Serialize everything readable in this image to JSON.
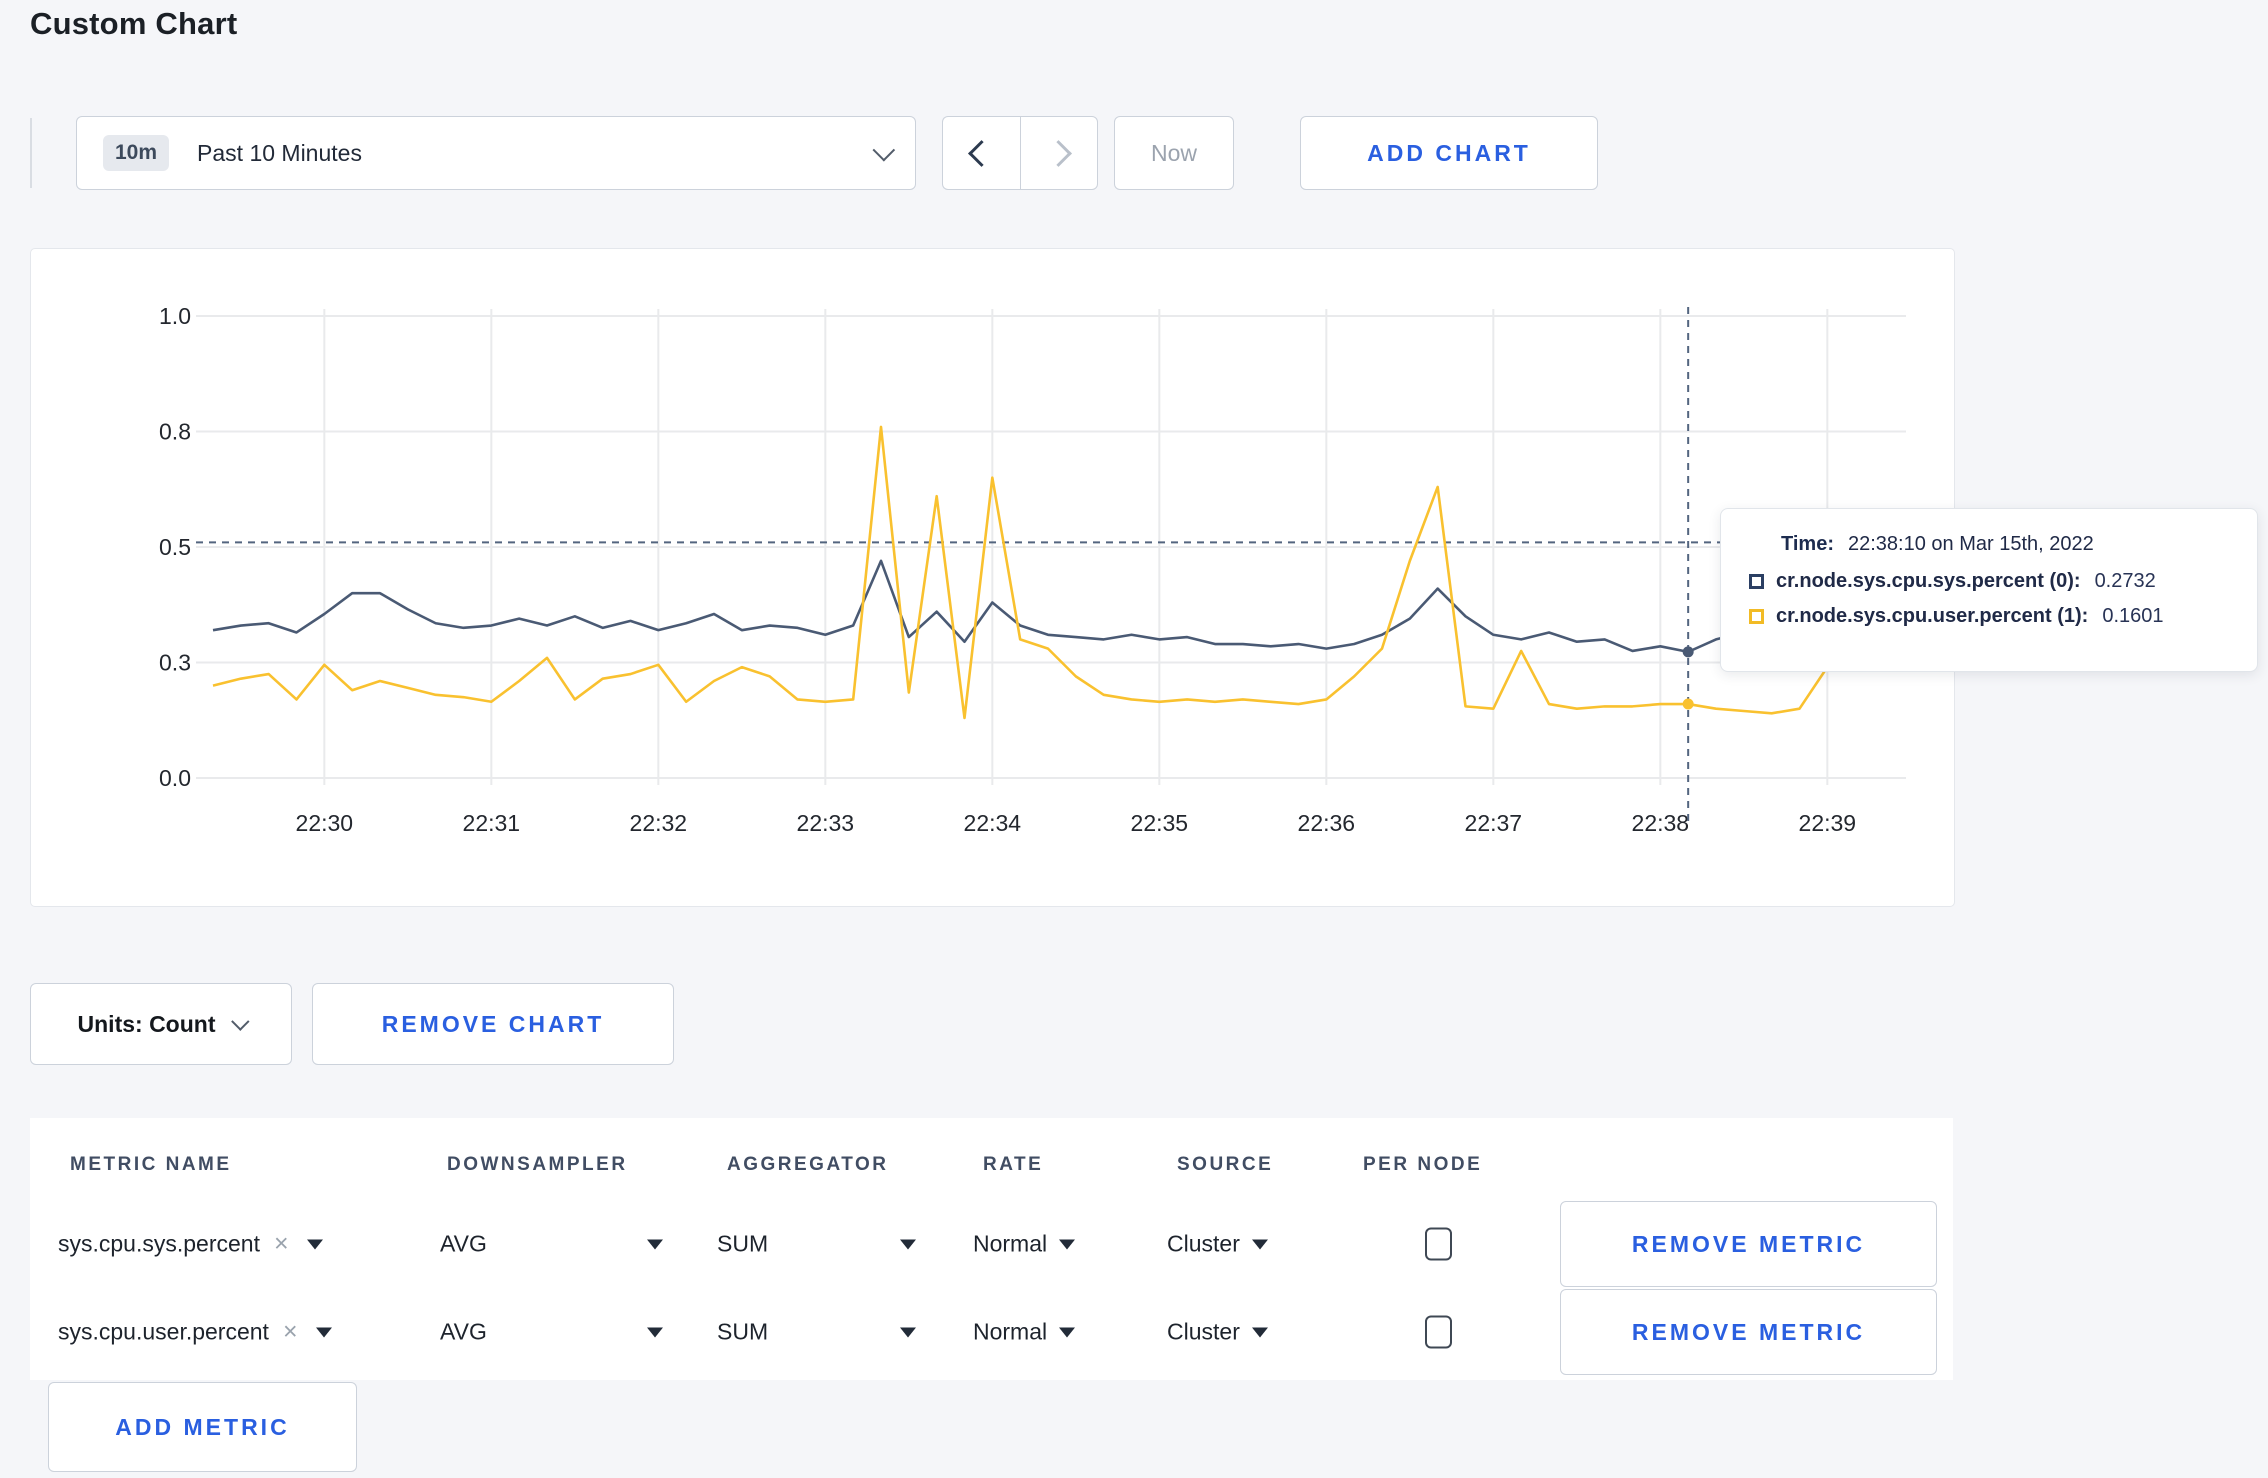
{
  "page": {
    "title": "Custom Chart"
  },
  "toolbar": {
    "time_window_badge": "10m",
    "time_window_label": "Past 10 Minutes",
    "dropdown_caret_icon": "chevron-down",
    "prev_icon": "chevron-left",
    "next_icon": "chevron-right",
    "now_label": "Now",
    "add_chart_label": "ADD CHART"
  },
  "colors": {
    "accent_blue": "#2a5fe0",
    "series_sys": "#4a5a74",
    "series_user": "#f9c12f",
    "grid": "#e9eaec",
    "crosshair": "#53657f",
    "axis_text": "#23272e"
  },
  "chart_data": {
    "type": "line",
    "title": "",
    "x_axis_ticks": [
      "22:30",
      "22:31",
      "22:32",
      "22:33",
      "22:34",
      "22:35",
      "22:36",
      "22:37",
      "22:38",
      "22:39"
    ],
    "y_axis_ticks": [
      {
        "label": "1.0",
        "value": 1.0
      },
      {
        "label": "0.8",
        "value": 0.75
      },
      {
        "label": "0.5",
        "value": 0.5
      },
      {
        "label": "0.3",
        "value": 0.25
      },
      {
        "label": "0.0",
        "value": 0.0
      }
    ],
    "ylim": [
      0,
      1
    ],
    "grid": true,
    "x_start_time": "22:29:20",
    "x_interval_seconds": 10,
    "series": [
      {
        "name": "cr.node.sys.cpu.sys.percent (0)",
        "color": "#4a5a74",
        "values": [
          0.32,
          0.33,
          0.335,
          0.315,
          0.355,
          0.4,
          0.4,
          0.365,
          0.335,
          0.325,
          0.33,
          0.345,
          0.33,
          0.35,
          0.325,
          0.34,
          0.32,
          0.335,
          0.355,
          0.32,
          0.33,
          0.325,
          0.31,
          0.33,
          0.47,
          0.305,
          0.36,
          0.295,
          0.38,
          0.33,
          0.31,
          0.305,
          0.3,
          0.31,
          0.3,
          0.305,
          0.29,
          0.29,
          0.285,
          0.29,
          0.28,
          0.29,
          0.31,
          0.345,
          0.41,
          0.35,
          0.31,
          0.3,
          0.315,
          0.295,
          0.3,
          0.275,
          0.285,
          0.273,
          0.3,
          0.315,
          0.3,
          0.295,
          0.31,
          0.305,
          0.3
        ]
      },
      {
        "name": "cr.node.sys.cpu.user.percent (1)",
        "color": "#f9c12f",
        "values": [
          0.2,
          0.215,
          0.225,
          0.17,
          0.245,
          0.19,
          0.21,
          0.195,
          0.18,
          0.175,
          0.165,
          0.21,
          0.26,
          0.17,
          0.215,
          0.225,
          0.245,
          0.165,
          0.21,
          0.24,
          0.22,
          0.17,
          0.165,
          0.17,
          0.76,
          0.185,
          0.61,
          0.13,
          0.65,
          0.3,
          0.28,
          0.22,
          0.18,
          0.17,
          0.165,
          0.17,
          0.165,
          0.17,
          0.165,
          0.16,
          0.17,
          0.22,
          0.28,
          0.47,
          0.63,
          0.155,
          0.15,
          0.275,
          0.16,
          0.15,
          0.155,
          0.155,
          0.16,
          0.1601,
          0.15,
          0.145,
          0.14,
          0.15,
          0.24,
          0.29,
          0.245
        ]
      }
    ],
    "crosshair": {
      "t_offset_seconds": 530,
      "hline_value": 0.51,
      "marker_values": [
        0.273,
        0.1601
      ]
    }
  },
  "tooltip": {
    "time_label": "Time:",
    "time_value": "22:38:10 on Mar 15th, 2022",
    "rows": [
      {
        "swatch": "navy-square-icon",
        "name": "cr.node.sys.cpu.sys.percent (0):",
        "value": "0.2732"
      },
      {
        "swatch": "yellow-square-icon",
        "name": "cr.node.sys.cpu.user.percent (1):",
        "value": "0.1601"
      }
    ]
  },
  "units_bar": {
    "units_label": "Units: Count",
    "units_caret_icon": "chevron-down",
    "remove_chart_label": "REMOVE CHART"
  },
  "metrics_table": {
    "headers": [
      "METRIC NAME",
      "DOWNSAMPLER",
      "AGGREGATOR",
      "RATE",
      "SOURCE",
      "PER NODE"
    ],
    "rows": [
      {
        "metric_name": "sys.cpu.sys.percent",
        "clear_icon": "×",
        "downsampler": "AVG",
        "aggregator": "SUM",
        "rate": "Normal",
        "source": "Cluster",
        "per_node_checked": false,
        "remove_label": "REMOVE METRIC"
      },
      {
        "metric_name": "sys.cpu.user.percent",
        "clear_icon": "×",
        "downsampler": "AVG",
        "aggregator": "SUM",
        "rate": "Normal",
        "source": "Cluster",
        "per_node_checked": false,
        "remove_label": "REMOVE METRIC"
      }
    ],
    "add_metric_label": "ADD METRIC"
  }
}
